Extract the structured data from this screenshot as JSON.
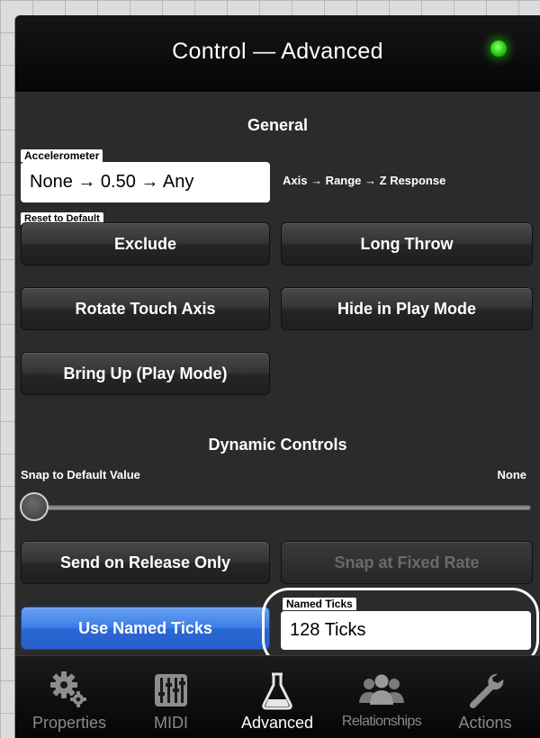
{
  "header": {
    "title": "Control — Advanced"
  },
  "general": {
    "section_title": "General",
    "accelerometer": {
      "label": "Accelerometer",
      "value": "None → 0.50 → Any",
      "hint": "Axis → Range → Z Response"
    },
    "reset_label": "Reset to Default",
    "buttons": [
      "Exclude",
      "Long Throw",
      "Rotate Touch Axis",
      "Hide in Play Mode",
      "Bring Up (Play Mode)"
    ]
  },
  "dynamic": {
    "section_title": "Dynamic Controls",
    "snap_label": "Snap to Default Value",
    "snap_value": "None",
    "slider_level": 0,
    "send_on_release": "Send on Release Only",
    "snap_fixed_rate": "Snap at Fixed Rate",
    "use_named_ticks": "Use Named Ticks",
    "named_ticks": {
      "label": "Named Ticks",
      "value": "128 Ticks"
    }
  },
  "tabs": [
    {
      "label": "Properties",
      "icon": "gears-icon",
      "active": false
    },
    {
      "label": "MIDI",
      "icon": "mixer-sliders-icon",
      "active": false
    },
    {
      "label": "Advanced",
      "icon": "flask-icon",
      "active": true
    },
    {
      "label": "Relationships",
      "icon": "people-icon",
      "active": false
    },
    {
      "label": "Actions",
      "icon": "wrench-icon",
      "active": false
    }
  ],
  "colors": {
    "status_led": "#2fd81c",
    "accent_button": "#3c7de8",
    "panel_background": "#2b2b2b"
  }
}
